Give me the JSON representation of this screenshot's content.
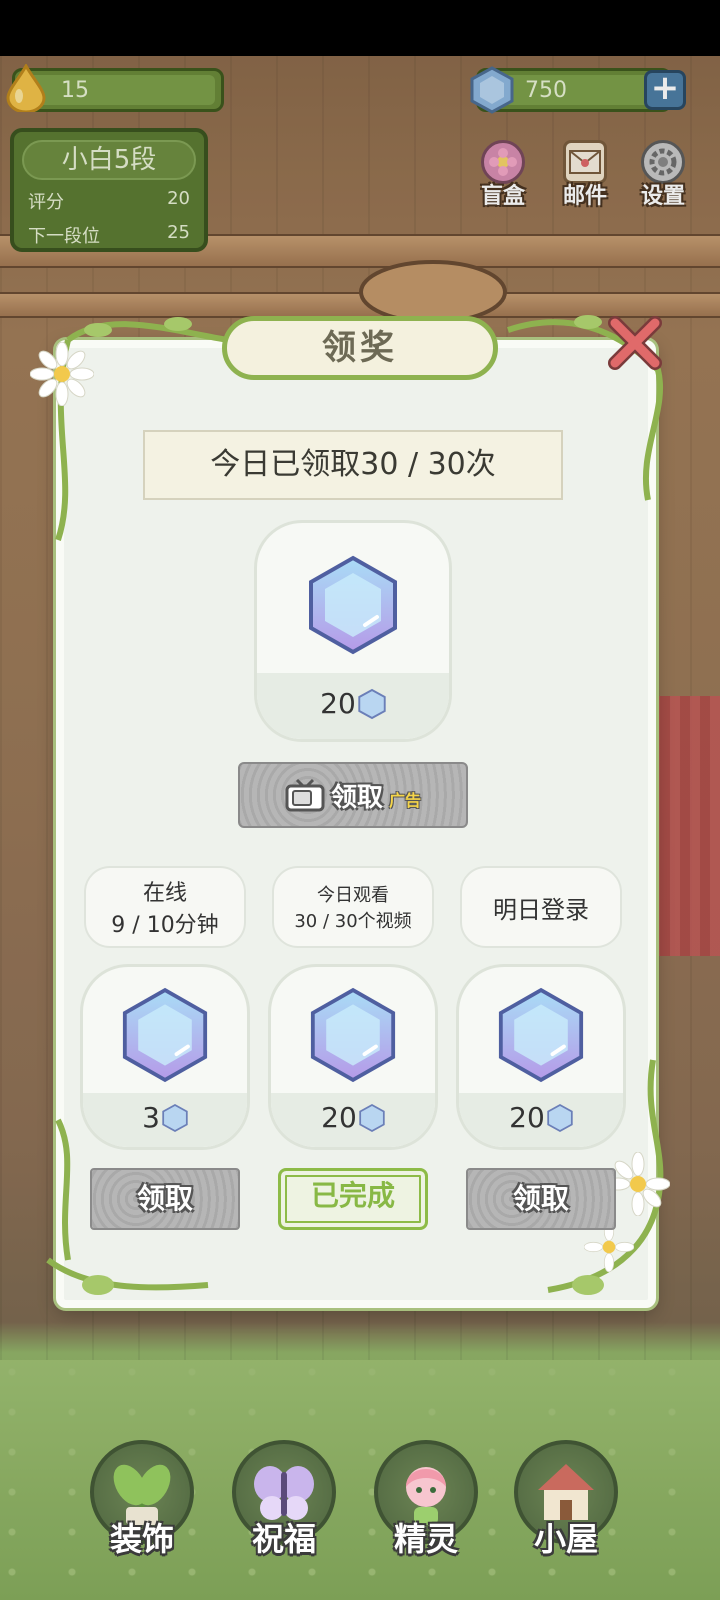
{
  "hud": {
    "water_value": "15",
    "gem_value": "750",
    "plus_label": "+",
    "rank": {
      "title": "小白5段",
      "score_label": "评分",
      "score_value": "20",
      "next_label": "下一段位",
      "next_value": "25"
    },
    "top_icons": [
      {
        "label": "盲盒",
        "icon": "gift-flower-icon"
      },
      {
        "label": "邮件",
        "icon": "mail-icon"
      },
      {
        "label": "设置",
        "icon": "gear-icon"
      }
    ]
  },
  "modal": {
    "title": "领奖",
    "claimed_text": "今日已领取30 / 30次",
    "main_reward": {
      "amount": "20",
      "icon": "gem-icon"
    },
    "ad_button": {
      "label": "领取",
      "tag": "广告",
      "icon": "tv-icon"
    },
    "tasks": [
      {
        "line1": "在线",
        "line2": "9 / 10分钟",
        "amount": "3",
        "button": "领取",
        "state": "available"
      },
      {
        "line1": "今日观看",
        "line2": "30 / 30个视频",
        "amount": "20",
        "button": "已完成",
        "state": "done"
      },
      {
        "line1": "明日登录",
        "line2": "",
        "amount": "20",
        "button": "领取",
        "state": "available"
      }
    ]
  },
  "bottom_nav": [
    {
      "label": "装饰",
      "icon": "plant-icon"
    },
    {
      "label": "祝福",
      "icon": "butterfly-icon"
    },
    {
      "label": "精灵",
      "icon": "fairy-icon"
    },
    {
      "label": "小屋",
      "icon": "house-icon"
    }
  ],
  "colors": {
    "vine_green": "#8eb24f",
    "modal_bg": "#eef2ec",
    "gem_blue": "#7fb6ea",
    "gem_purple": "#b59ae8",
    "close_red": "#e06a6a"
  }
}
